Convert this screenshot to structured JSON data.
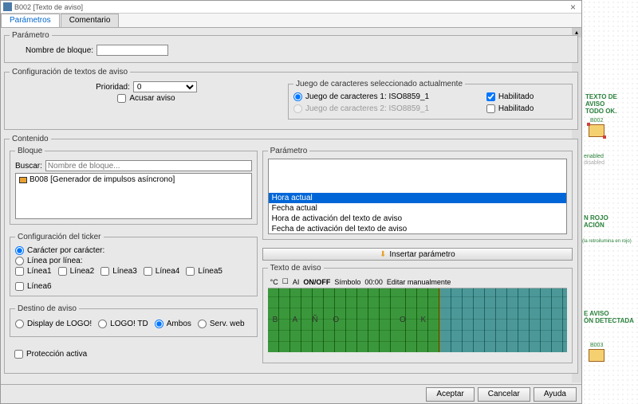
{
  "titlebar": {
    "title": "B002 [Texto de aviso]"
  },
  "tabs": {
    "parametros": "Parámetros",
    "comentario": "Comentario"
  },
  "section_parametro": {
    "legend": "Parámetro",
    "block_name_label": "Nombre de bloque:",
    "block_name_value": ""
  },
  "section_config_textos": {
    "legend": "Configuración de textos de aviso",
    "priority_label": "Prioridad:",
    "priority_value": "0",
    "ack_label": "Acusar aviso"
  },
  "section_charset": {
    "legend": "Juego de caracteres seleccionado actualmente",
    "set1_label": "Juego de caracteres 1: ISO8859_1",
    "set2_label": "Juego de caracteres 2: ISO8859_1",
    "enabled_label": "Habilitado"
  },
  "section_contenido": {
    "legend": "Contenido"
  },
  "section_bloque": {
    "legend": "Bloque",
    "search_label": "Buscar:",
    "search_placeholder": "Nombre de bloque...",
    "items": [
      "B008 [Generador de impulsos asíncrono]"
    ]
  },
  "section_param_list": {
    "legend": "Parámetro",
    "items": [
      "Hora actual",
      "Fecha actual",
      "Hora de activación del texto de aviso",
      "Fecha de activación del texto de aviso"
    ],
    "selected_index": 0
  },
  "insert_label": "Insertar parámetro",
  "section_ticker": {
    "legend": "Configuración del ticker",
    "char_by_char": "Carácter por carácter:",
    "line_by_line": "Línea por línea:",
    "lines": [
      "Línea1",
      "Línea2",
      "Línea3",
      "Línea4",
      "Línea5",
      "Línea6"
    ]
  },
  "section_destino": {
    "legend": "Destino de aviso",
    "options": [
      "Display de LOGO!",
      "LOGO! TD",
      "Ambos",
      "Serv. web"
    ]
  },
  "section_proteccion": {
    "label": "Protección activa"
  },
  "section_texto_aviso": {
    "legend": "Texto de aviso",
    "toolbar": {
      "degC": "°C",
      "cursor": "☐",
      "ai": "AI",
      "onoff": "ON/OFF",
      "simbolo": "Símbolo",
      "time": "00:00",
      "editar": "Editar manualmente"
    },
    "grid_text_left": "B A Ñ O",
    "grid_text_right": "O K"
  },
  "footer": {
    "ok": "Aceptar",
    "cancel": "Cancelar",
    "help": "Ayuda"
  },
  "canvas": {
    "label1a": "TEXTO DE AVISO",
    "label1b": "TODO OK.",
    "block1": "B002",
    "en": "enabled",
    "dis": "disabled",
    "label2a": "N ROJO",
    "label2b": "ACIÓN",
    "hint": "(la retroilumina en rojo)",
    "label3a": "E AVISO",
    "label3b": "ÓN DETECTADA",
    "block2": "B003"
  }
}
